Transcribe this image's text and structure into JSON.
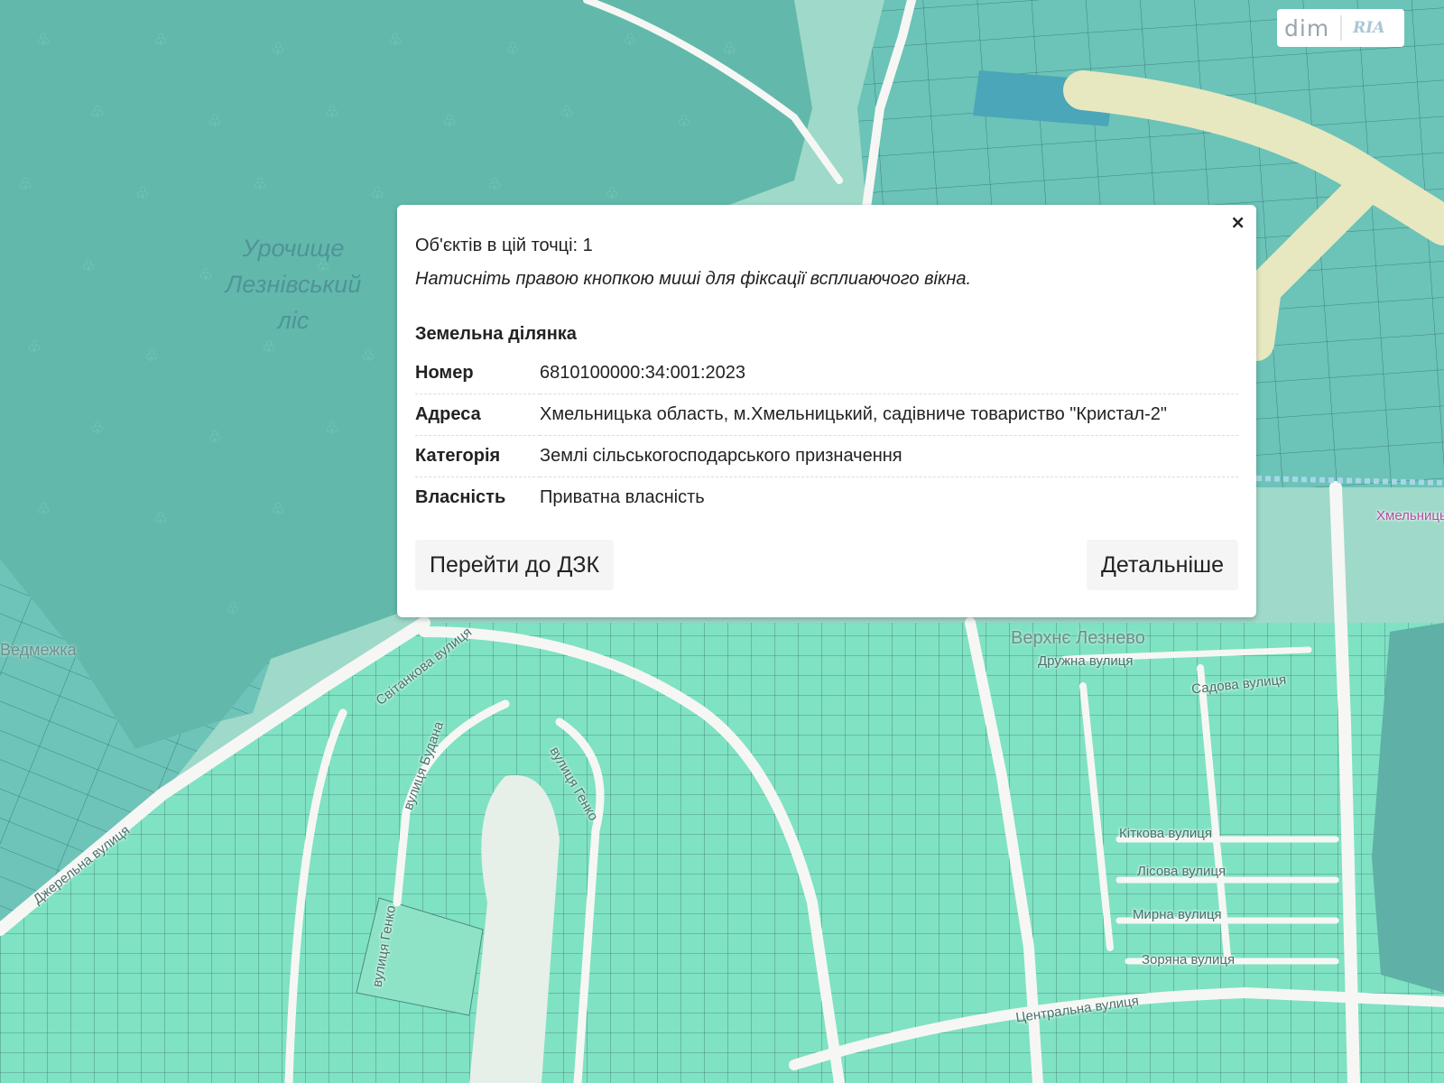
{
  "map": {
    "area_label_lines": [
      "Урочище",
      "Лезнівський",
      "ліс"
    ],
    "village_labels": [
      "Верхнє Лезнево",
      "Ведмежка"
    ],
    "street_labels": [
      "Світанкова вулиця",
      "вулиця Будана",
      "вулиця Генко",
      "Джерельна вулиця",
      "вулиця Генко",
      "Центральна вулиця",
      "Кіткова вулиця",
      "Лісова вулиця",
      "Мирна вулиця",
      "Зоряна вулиця",
      "Садова вулиця",
      "Дружна вулиця",
      "Хмельницька"
    ],
    "colors": {
      "forest": "#62b9ab",
      "parcel": "#7ee0c0",
      "road": "#ffffff",
      "field": "#5fb7b1"
    }
  },
  "watermark": {
    "brand_left": "dim",
    "brand_right": "RIA"
  },
  "popup": {
    "close_symbol": "×",
    "objects_count": "Об'єктів в цій точці: 1",
    "hint": "Натисніть правою кнопкою миші для фіксації всплиаючого вікна.",
    "section_title": "Земельна ділянка",
    "rows": [
      {
        "key": "Номер",
        "value": "6810100000:34:001:2023"
      },
      {
        "key": "Адреса",
        "value": "Хмельницька область, м.Хмельницький, садівниче товариство \"Кристал-2\""
      },
      {
        "key": "Категорія",
        "value": "Землі сільськогосподарського призначення"
      },
      {
        "key": "Власність",
        "value": "Приватна власність"
      }
    ],
    "button_dzk": "Перейти до ДЗК",
    "button_details": "Детальніше"
  }
}
